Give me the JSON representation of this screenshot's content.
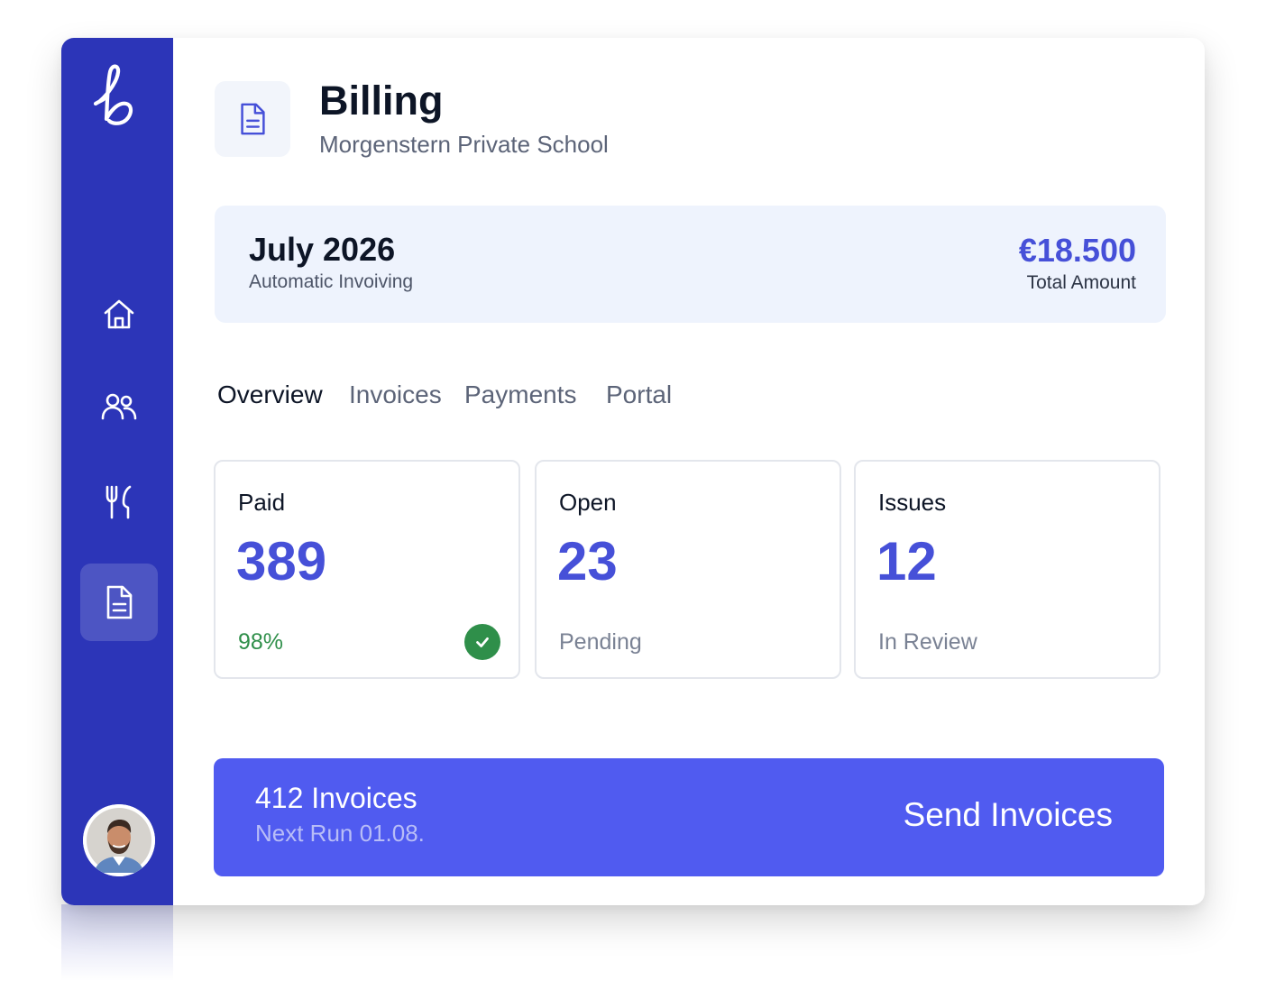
{
  "header": {
    "title": "Billing",
    "subtitle": "Morgenstern Private School"
  },
  "sidebar": {
    "items": [
      {
        "icon": "home-icon"
      },
      {
        "icon": "users-icon"
      },
      {
        "icon": "cutlery-icon"
      },
      {
        "icon": "document-icon",
        "active": true
      }
    ],
    "avatar": "user-avatar"
  },
  "period": {
    "title": "July 2026",
    "subtitle": "Automatic Invoiving",
    "total_amount": "€18.500",
    "total_label": "Total Amount"
  },
  "tabs": [
    {
      "label": "Overview",
      "active": true
    },
    {
      "label": "Invoices"
    },
    {
      "label": "Payments"
    },
    {
      "label": "Portal"
    }
  ],
  "stats": {
    "paid": {
      "label": "Paid",
      "value": "389",
      "foot": "98%"
    },
    "open": {
      "label": "Open",
      "value": "23",
      "foot": "Pending"
    },
    "issues": {
      "label": "Issues",
      "value": "12",
      "foot": "In Review"
    }
  },
  "cta": {
    "count": "412 Invoices",
    "next_run": "Next Run 01.08.",
    "button_label": "Send Invoices"
  },
  "colors": {
    "sidebar": "#2c35b8",
    "accent": "#4650d8",
    "cta": "#505bf0",
    "success": "#2f8f4a",
    "period_bg": "#eef3fd"
  }
}
